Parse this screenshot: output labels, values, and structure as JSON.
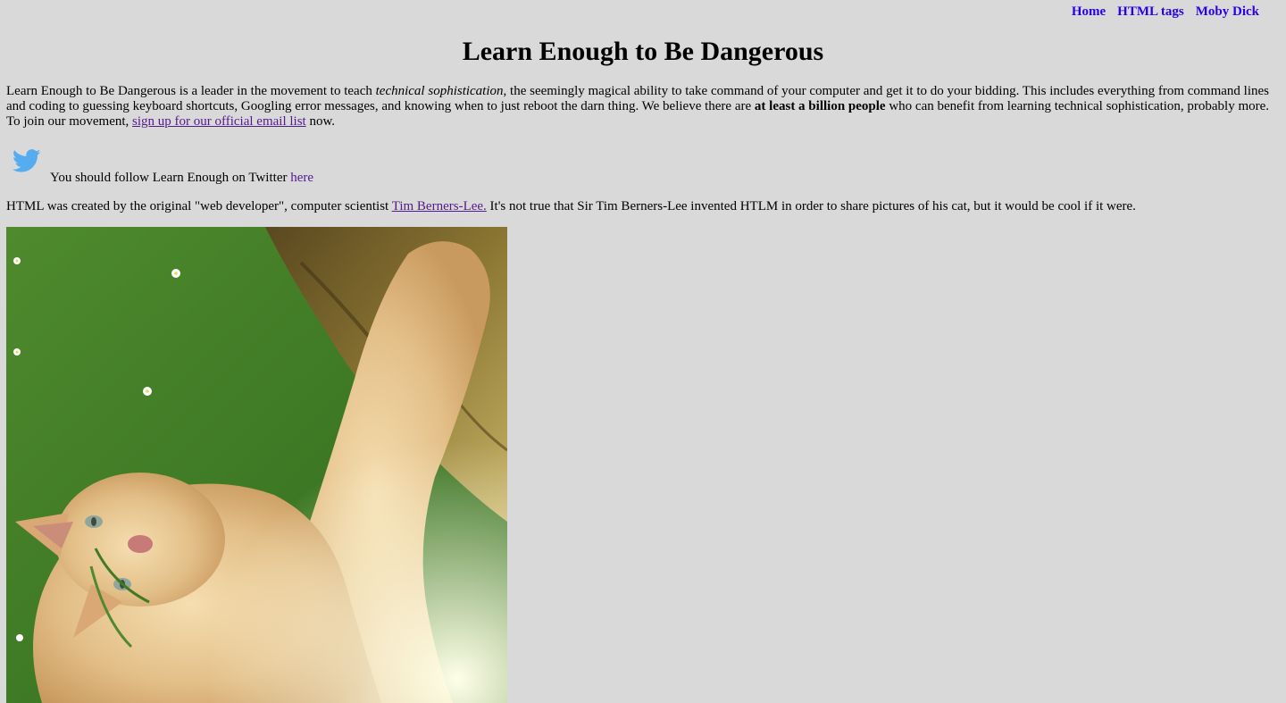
{
  "nav": {
    "home": "Home",
    "html_tags": "HTML tags",
    "moby_dick": "Moby Dick"
  },
  "page": {
    "title": "Learn Enough to Be Dangerous"
  },
  "intro": {
    "part1": "Learn Enough to Be Dangerous is a leader in the movement to teach ",
    "em": "technical sophistication",
    "part2": ", the seemingly magical ability to take command of your computer and get it to do your bidding. This includes everything from command lines and coding to guessing keyboard shortcuts, Googling error messages, and knowing when to just reboot the darn thing. We believe there are ",
    "strong": "at least a billion people",
    "part3": " who can benefit from learning technical sophistication, probably more. To join our movement, ",
    "link": "sign up for our official email list",
    "part4": " now."
  },
  "twitter": {
    "icon": "twitter-bird-icon",
    "text": "You should follow Learn Enough on Twitter ",
    "link": "here",
    "icon_color": "#55acee"
  },
  "tbl": {
    "part1": "HTML was created by the original \"web developer\", computer scientist ",
    "link": "Tim Berners-Lee.",
    "part2": " It's not true that Sir Tim Berners-Lee invented HTLM in order to share pictures of his cat, but it would be cool if it were."
  },
  "image": {
    "subject": "cat photo"
  },
  "colors": {
    "background": "#d9d9d9",
    "nav_link": "#2a00e6",
    "visited_link": "#551a8b"
  }
}
